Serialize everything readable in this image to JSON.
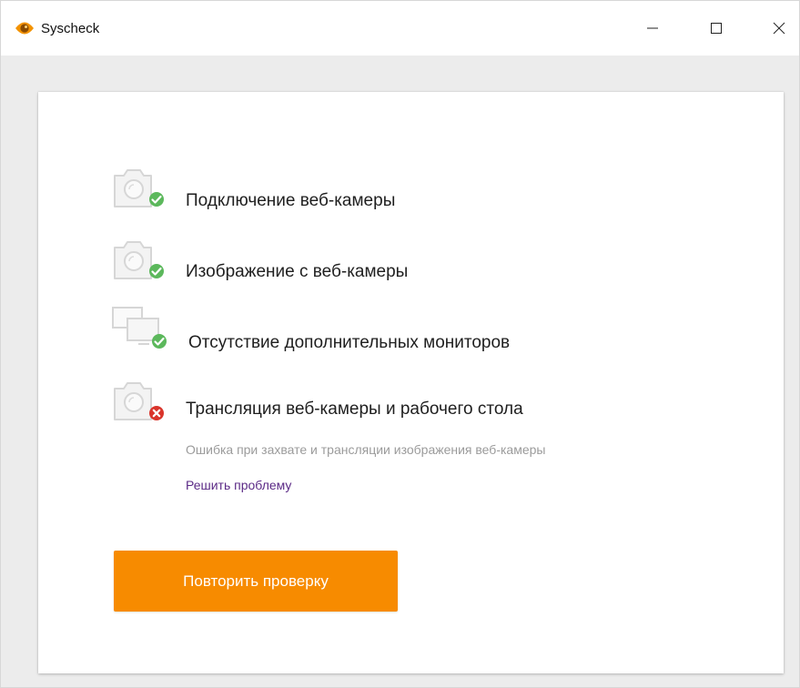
{
  "window": {
    "title": "Syscheck",
    "app_icon": "eye-logo-icon",
    "controls": [
      "minimize-icon",
      "maximize-icon",
      "close-icon"
    ]
  },
  "checks": [
    {
      "label": "Подключение веб-камеры",
      "icon": "webcam-icon",
      "status": "ok"
    },
    {
      "label": "Изображение с веб-камеры",
      "icon": "webcam-icon",
      "status": "ok"
    },
    {
      "label": "Отсутствие дополнительных мониторов",
      "icon": "monitors-icon",
      "status": "ok"
    },
    {
      "label": "Трансляция веб-камеры и рабочего стола",
      "icon": "webcam-icon",
      "status": "error"
    }
  ],
  "error": {
    "message": "Ошибка при захвате и трансляции изображения веб-камеры",
    "fix_link": "Решить проблему"
  },
  "actions": {
    "retry_label": "Повторить проверку"
  },
  "colors": {
    "accent": "#f78b00",
    "ok": "#5cb85c",
    "error": "#d9342b",
    "link": "#5b2a86"
  }
}
